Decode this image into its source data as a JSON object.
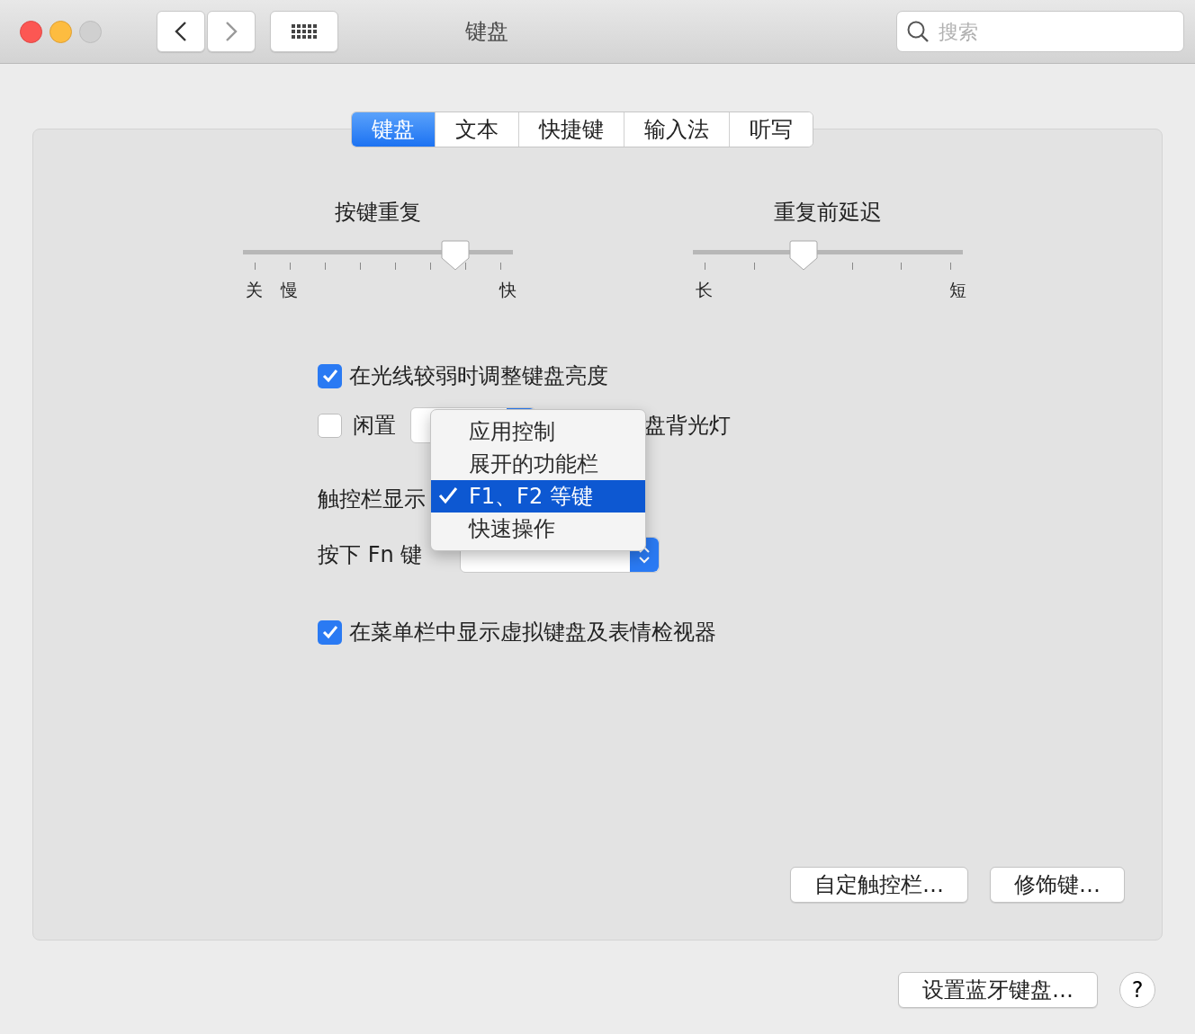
{
  "window": {
    "title": "键盘",
    "search": {
      "placeholder": "搜索"
    }
  },
  "tabs": [
    {
      "label": "键盘",
      "selected": true
    },
    {
      "label": "文本",
      "selected": false
    },
    {
      "label": "快捷键",
      "selected": false
    },
    {
      "label": "输入法",
      "selected": false
    },
    {
      "label": "听写",
      "selected": false
    }
  ],
  "sliders": [
    {
      "kind": "rate",
      "title": "按键重复",
      "level": 0.82,
      "start_labels": [
        "关",
        "慢"
      ],
      "end_label": "快"
    },
    {
      "kind": "delay",
      "title": "重复前延迟",
      "level": 0.4,
      "start_labels": [
        "长"
      ],
      "end_label": "短"
    }
  ],
  "brightness": {
    "label": "在光线较弱时调整键盘亮度",
    "checked": true
  },
  "idle": {
    "label": "闲置",
    "checked": false,
    "trailing": "盘背光灯"
  },
  "touch_bar": {
    "label": "触控栏显示"
  },
  "fn_key": {
    "label": "按下 Fn 键"
  },
  "menu": [
    {
      "label": "应用控制",
      "selected": false
    },
    {
      "label": "展开的功能栏",
      "selected": false
    },
    {
      "label": "F1、F2 等键",
      "selected": true
    },
    {
      "label": "快速操作",
      "selected": false
    }
  ],
  "viewer": {
    "label": "在菜单栏中显示虚拟键盘及表情检视器",
    "checked": true
  },
  "panel_buttons": [
    "自定触控栏…",
    "修饰键…"
  ],
  "footer": {
    "button": "设置蓝牙键盘…",
    "help": "?"
  }
}
